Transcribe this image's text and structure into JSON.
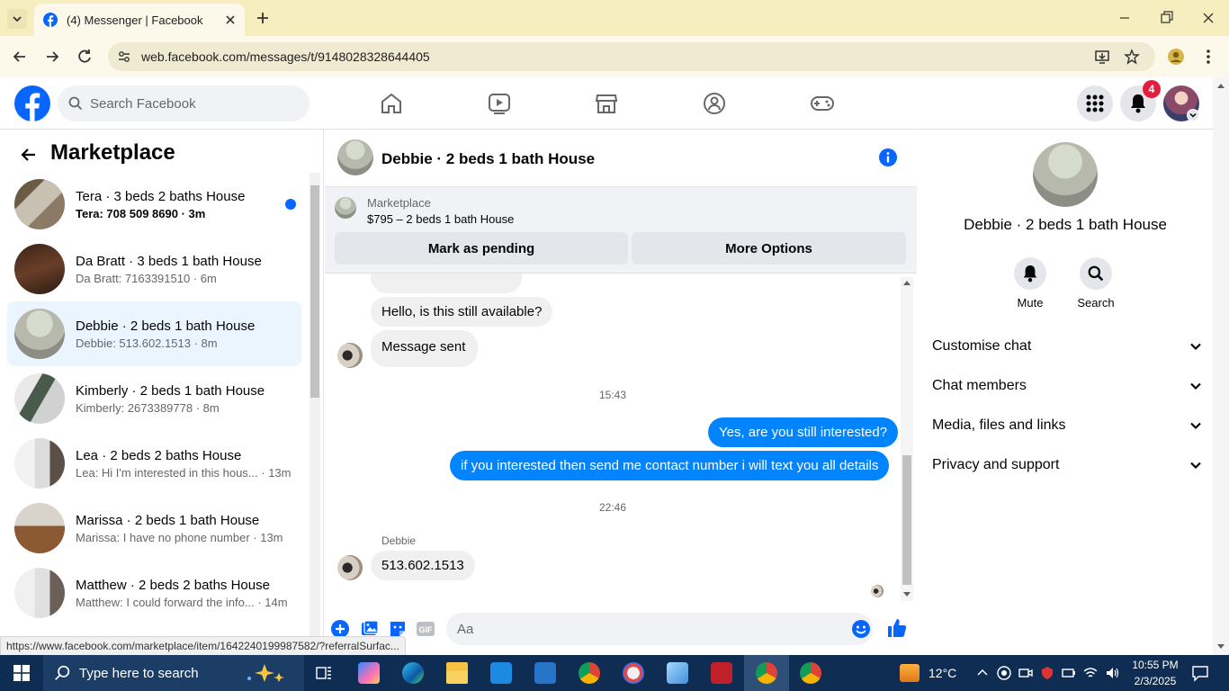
{
  "browser": {
    "tab_title": "(4) Messenger | Facebook",
    "url": "web.facebook.com/messages/t/9148028328644405",
    "status_url": "https://www.facebook.com/marketplace/item/1642240199987582/?referralSurfac..."
  },
  "header": {
    "search_placeholder": "Search Facebook",
    "notif_count": "4"
  },
  "sidebar": {
    "title": "Marketplace",
    "conversations": [
      {
        "title": "Tera · 3 beds 2 baths House",
        "snippet": "Tera: 708 509 8690 · 3m",
        "unread": true
      },
      {
        "title": "Da Bratt · 3 beds 1 bath House",
        "snippet": "Da Bratt: 7163391510 · 6m"
      },
      {
        "title": "Debbie · 2 beds 1 bath House",
        "snippet": "Debbie: 513.602.1513 · 8m",
        "selected": true
      },
      {
        "title": "Kimberly · 2 beds 1 bath House",
        "snippet": "Kimberly: 2673389778 · 8m"
      },
      {
        "title": "Lea · 2 beds 2 baths House",
        "snippet": "Lea: Hi I'm interested in this hous... · 13m"
      },
      {
        "title": "Marissa · 2 beds 1 bath House",
        "snippet": "Marissa: I have no phone number · 13m"
      },
      {
        "title": "Matthew · 2 beds 2 baths House",
        "snippet": "Matthew: I could forward the info... · 14m"
      }
    ]
  },
  "chat": {
    "title": "Debbie · 2 beds 1 bath House",
    "listing_label": "Marketplace",
    "listing_price": "$795 – 2 beds 1 bath House",
    "pending_button": "Mark as pending",
    "more_button": "More Options",
    "messages": {
      "m1": "Hello, is this still available?",
      "m2": "Message sent",
      "time1": "15:43",
      "m3": "Yes, are you still interested?",
      "m4": "if you interested then send me contact number i will text you all details",
      "time2": "22:46",
      "sender": "Debbie",
      "m5": "513.602.1513"
    },
    "composer_placeholder": "Aa"
  },
  "details": {
    "title": "Debbie · 2 beds 1 bath House",
    "mute_label": "Mute",
    "search_label": "Search",
    "sections": [
      "Customise chat",
      "Chat members",
      "Media, files and links",
      "Privacy and support"
    ]
  },
  "taskbar": {
    "search_placeholder": "Type here to search",
    "temperature": "12°C",
    "time": "10:55 PM",
    "date": "2/3/2025"
  },
  "colors": {
    "accent": "#0866ff",
    "bubble_me": "#0084ff",
    "chrome_frame": "#f6eebf"
  }
}
